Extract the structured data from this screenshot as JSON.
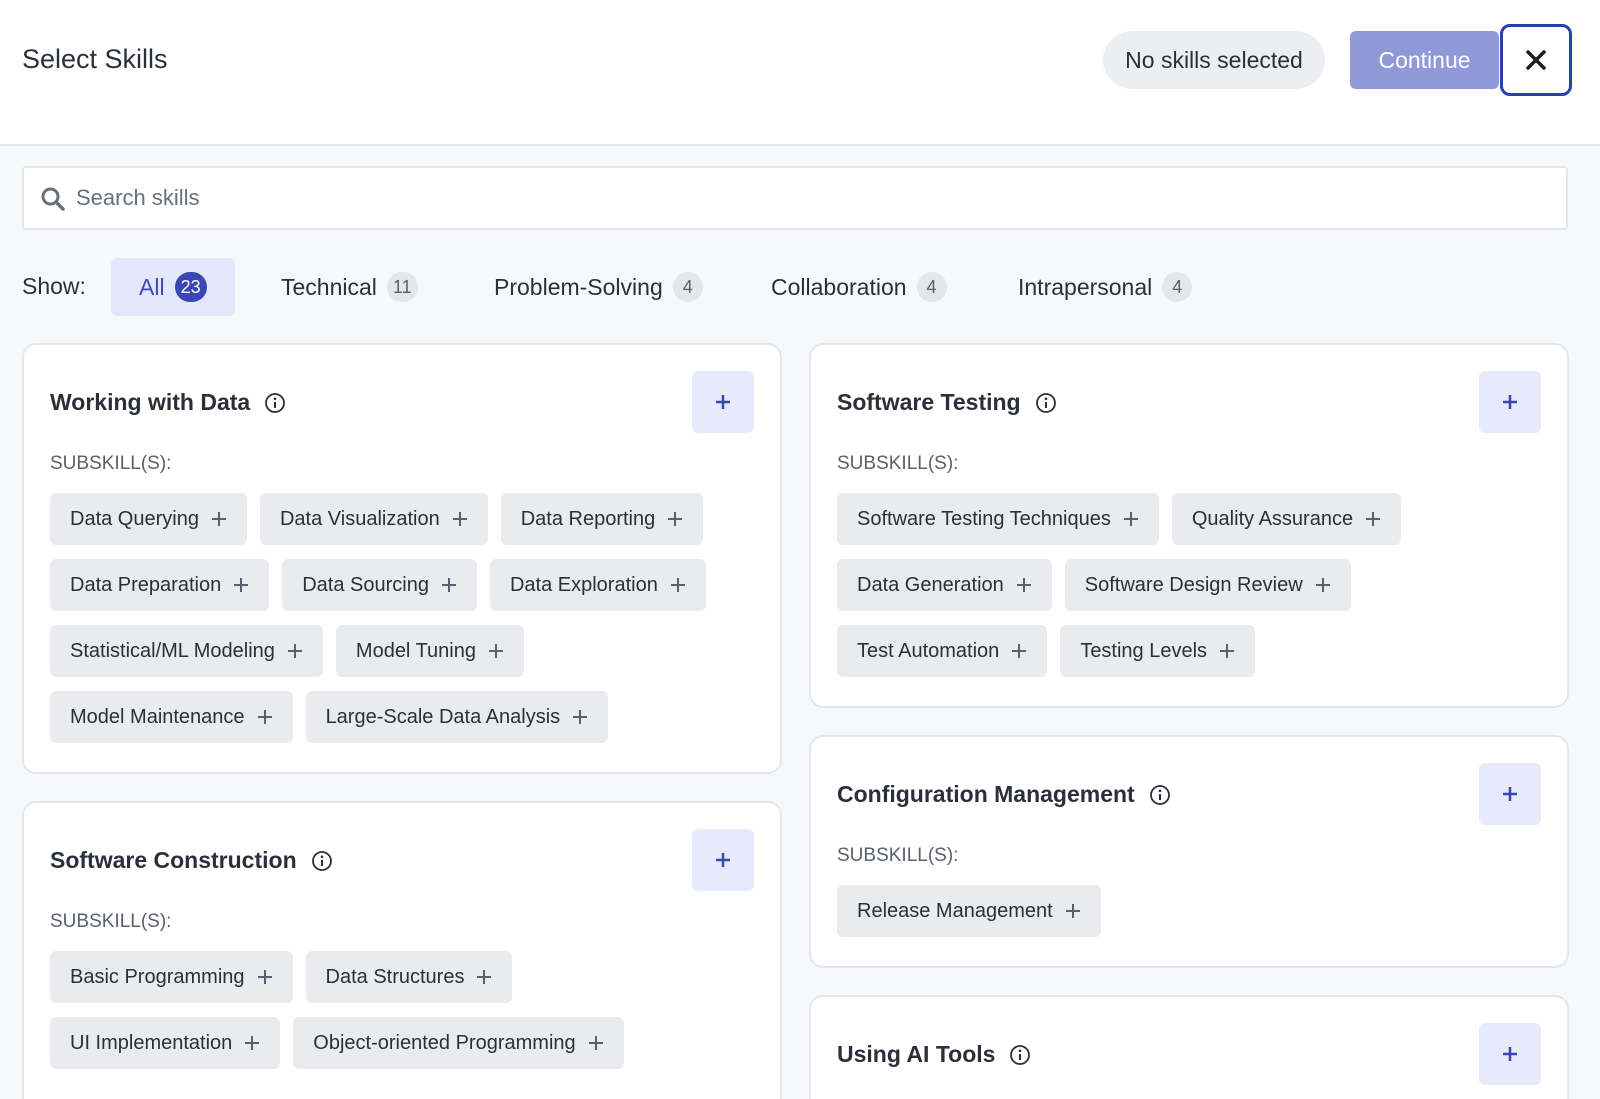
{
  "header": {
    "title": "Select Skills",
    "status": "No skills selected",
    "continue_label": "Continue"
  },
  "search": {
    "placeholder": "Search skills"
  },
  "filters": {
    "show_label": "Show:",
    "items": [
      {
        "label": "All",
        "count": "23",
        "active": true
      },
      {
        "label": "Technical",
        "count": "11"
      },
      {
        "label": "Problem-Solving",
        "count": "4"
      },
      {
        "label": "Collaboration",
        "count": "4"
      },
      {
        "label": "Intrapersonal",
        "count": "4"
      }
    ]
  },
  "subskill_label": "SUBSKILL(S):",
  "cards": [
    {
      "title": "Working with Data",
      "chips": [
        "Data Querying",
        "Data Visualization",
        "Data Reporting",
        "Data Preparation",
        "Data Sourcing",
        "Data Exploration",
        "Statistical/ML Modeling",
        "Model Tuning",
        "Model Maintenance",
        "Large-Scale Data Analysis"
      ]
    },
    {
      "title": "Software Construction",
      "chips": [
        "Basic Programming",
        "Data Structures",
        "UI Implementation",
        "Object-oriented Programming"
      ]
    },
    {
      "title": "Software Testing",
      "chips": [
        "Software Testing Techniques",
        "Quality Assurance",
        "Data Generation",
        "Software Design Review",
        "Test Automation",
        "Testing Levels"
      ]
    },
    {
      "title": "Configuration Management",
      "chips": [
        "Release Management"
      ]
    },
    {
      "title": "Using AI Tools",
      "chips": []
    }
  ],
  "colors": {
    "accent": "#3a46b3",
    "continue_disabled": "#8f99d8",
    "chip_bg": "#e9ebef",
    "add_bg": "#e7eafb"
  },
  "icons": [
    "search-icon",
    "close-icon",
    "info-icon",
    "plus-icon"
  ]
}
